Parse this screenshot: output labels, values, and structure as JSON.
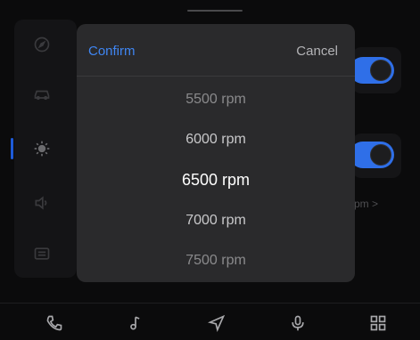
{
  "picker": {
    "confirm_label": "Confirm",
    "cancel_label": "Cancel",
    "options": [
      "5500 rpm",
      "6000 rpm",
      "6500 rpm",
      "7000 rpm",
      "7500 rpm"
    ],
    "selected_index": 2
  },
  "background": {
    "partial_value": "pm >",
    "toggle_states": [
      true,
      true
    ]
  },
  "side_nav": {
    "icons": [
      "compass-icon",
      "car-icon",
      "brightness-icon",
      "volume-icon",
      "display-icon"
    ],
    "active": "brightness-icon"
  },
  "bottom_nav": {
    "icons": [
      "phone-icon",
      "music-icon",
      "navigation-icon",
      "microphone-icon",
      "apps-grid-icon"
    ]
  },
  "colors": {
    "accent": "#3f86f3",
    "toggle_on": "#2f6fe8",
    "picker_bg": "#2a2a2c",
    "screen_bg": "#0b0b0c"
  }
}
